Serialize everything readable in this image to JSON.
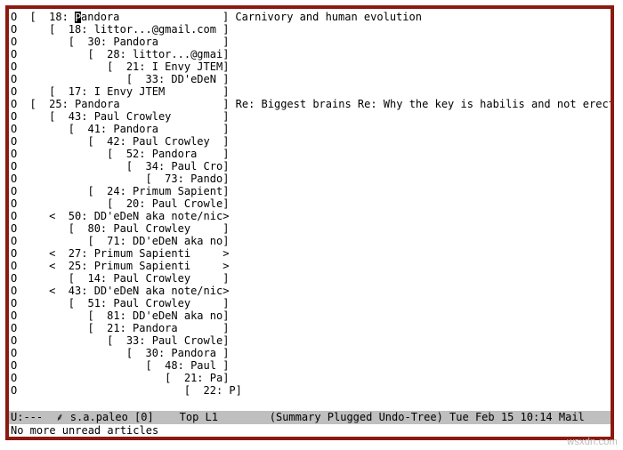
{
  "threads": [
    {
      "indent": 0,
      "mark": "O",
      "open": "[",
      "close": "]",
      "count": 18,
      "author": "Pandora",
      "subject": "Carnivory and human evolution",
      "cursor": true
    },
    {
      "indent": 1,
      "mark": "O",
      "open": "[",
      "close": "]",
      "count": 18,
      "author": "littor...@gmail.com",
      "subject": ""
    },
    {
      "indent": 2,
      "mark": "O",
      "open": "[",
      "close": "]",
      "count": 30,
      "author": "Pandora",
      "subject": ""
    },
    {
      "indent": 3,
      "mark": "O",
      "open": "[",
      "close": "]",
      "count": 28,
      "author": "littor...@gmail.com",
      "subject": ""
    },
    {
      "indent": 4,
      "mark": "O",
      "open": "[",
      "close": "]",
      "count": 21,
      "author": "I Envy JTEM",
      "subject": ""
    },
    {
      "indent": 5,
      "mark": "O",
      "open": "[",
      "close": "]",
      "count": 33,
      "author": "DD'eDeN aka note/nickna",
      "subject": ""
    },
    {
      "indent": 1,
      "mark": "O",
      "open": "[",
      "close": "]",
      "count": 17,
      "author": "I Envy JTEM",
      "subject": ""
    },
    {
      "indent": 0,
      "mark": "O",
      "open": "[",
      "close": "]",
      "count": 25,
      "author": "Pandora",
      "subject": "Re: Biggest brains Re: Why the key is habilis and not erectus"
    },
    {
      "indent": 1,
      "mark": "O",
      "open": "[",
      "close": "]",
      "count": 43,
      "author": "Paul Crowley",
      "subject": ""
    },
    {
      "indent": 2,
      "mark": "O",
      "open": "[",
      "close": "]",
      "count": 41,
      "author": "Pandora",
      "subject": ""
    },
    {
      "indent": 3,
      "mark": "O",
      "open": "[",
      "close": "]",
      "count": 42,
      "author": "Paul Crowley",
      "subject": ""
    },
    {
      "indent": 4,
      "mark": "O",
      "open": "[",
      "close": "]",
      "count": 52,
      "author": "Pandora",
      "subject": ""
    },
    {
      "indent": 5,
      "mark": "O",
      "open": "[",
      "close": "]",
      "count": 34,
      "author": "Paul Crowley",
      "subject": ""
    },
    {
      "indent": 6,
      "mark": "O",
      "open": "[",
      "close": "]",
      "count": 73,
      "author": "Pandora",
      "subject": ""
    },
    {
      "indent": 3,
      "mark": "O",
      "open": "[",
      "close": "]",
      "count": 24,
      "author": "Primum Sapienti",
      "subject": ""
    },
    {
      "indent": 4,
      "mark": "O",
      "open": "[",
      "close": "]",
      "count": 20,
      "author": "Paul Crowley",
      "subject": ""
    },
    {
      "indent": 1,
      "mark": "O",
      "open": "<",
      "close": ">",
      "count": 50,
      "author": "DD'eDeN aka note/nickna",
      "subject": ""
    },
    {
      "indent": 2,
      "mark": "O",
      "open": "[",
      "close": "]",
      "count": 80,
      "author": "Paul Crowley",
      "subject": ""
    },
    {
      "indent": 3,
      "mark": "O",
      "open": "[",
      "close": "]",
      "count": 71,
      "author": "DD'eDeN aka note/nickna",
      "subject": ""
    },
    {
      "indent": 1,
      "mark": "O",
      "open": "<",
      "close": ">",
      "count": 27,
      "author": "Primum Sapienti",
      "subject": ""
    },
    {
      "indent": 1,
      "mark": "O",
      "open": "<",
      "close": ">",
      "count": 25,
      "author": "Primum Sapienti",
      "subject": ""
    },
    {
      "indent": 2,
      "mark": "O",
      "open": "[",
      "close": "]",
      "count": 14,
      "author": "Paul Crowley",
      "subject": ""
    },
    {
      "indent": 1,
      "mark": "O",
      "open": "<",
      "close": ">",
      "count": 43,
      "author": "DD'eDeN aka note/nickna",
      "subject": ""
    },
    {
      "indent": 2,
      "mark": "O",
      "open": "[",
      "close": "]",
      "count": 51,
      "author": "Paul Crowley",
      "subject": ""
    },
    {
      "indent": 3,
      "mark": "O",
      "open": "[",
      "close": "]",
      "count": 81,
      "author": "DD'eDeN aka note/nickna",
      "subject": ""
    },
    {
      "indent": 3,
      "mark": "O",
      "open": "[",
      "close": "]",
      "count": 21,
      "author": "Pandora",
      "subject": ""
    },
    {
      "indent": 4,
      "mark": "O",
      "open": "[",
      "close": "]",
      "count": 33,
      "author": "Paul Crowley",
      "subject": ""
    },
    {
      "indent": 5,
      "mark": "O",
      "open": "[",
      "close": "]",
      "count": 30,
      "author": "Pandora",
      "subject": ""
    },
    {
      "indent": 6,
      "mark": "O",
      "open": "[",
      "close": "]",
      "count": 48,
      "author": "Paul Crowley",
      "subject": ""
    },
    {
      "indent": 7,
      "mark": "O",
      "open": "[",
      "close": "]",
      "count": 21,
      "author": "Pandora",
      "subject": ""
    },
    {
      "indent": 8,
      "mark": "O",
      "open": "[",
      "close": "]",
      "count": 22,
      "author": "Paul Crowley",
      "subject": ""
    }
  ],
  "modeline": {
    "left": "U:---",
    "plug": "⸙",
    "buffer": "s.a.paleo [0]",
    "pos": "Top L1",
    "modes": "(Summary Plugged Undo-Tree)",
    "clock": "Tue Feb 15 10:14",
    "tag": "Mail"
  },
  "echo": "No more unread articles",
  "watermark": "wsxdn.com"
}
